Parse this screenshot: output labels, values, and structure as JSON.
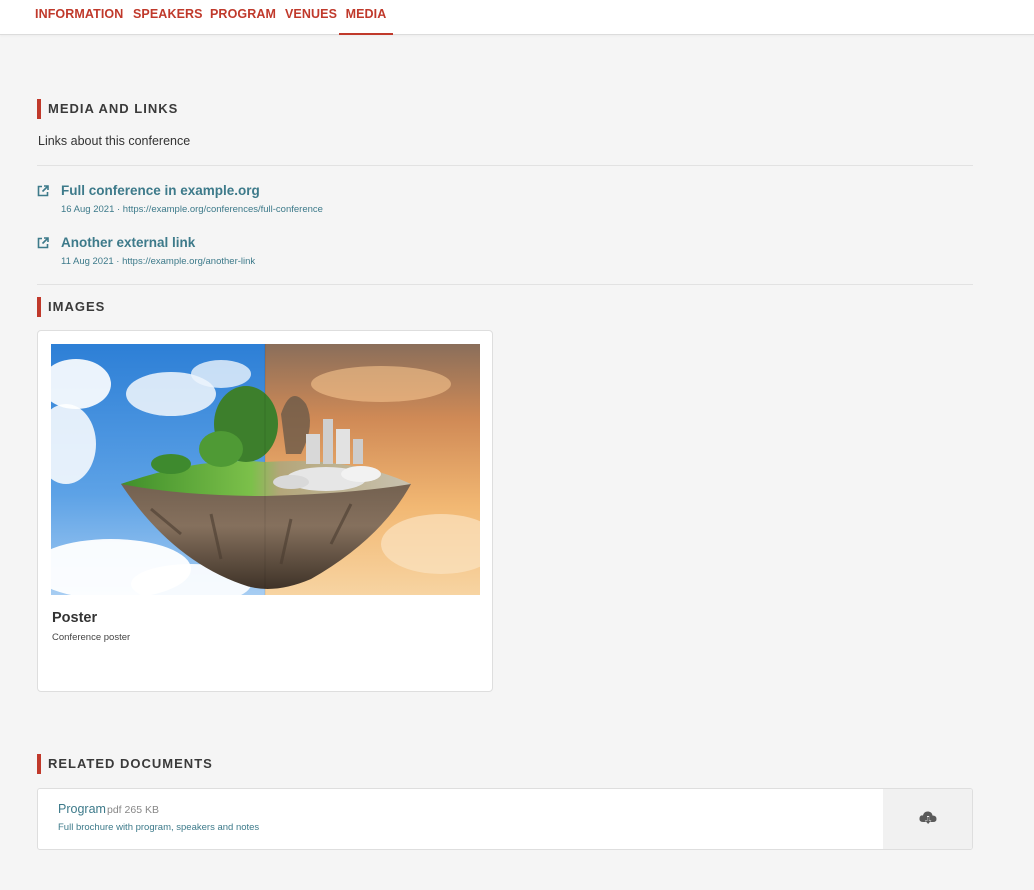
{
  "nav": {
    "tabs": [
      {
        "label": "INFORMATION"
      },
      {
        "label": "SPEAKERS"
      },
      {
        "label": "PROGRAM"
      },
      {
        "label": "VENUES"
      },
      {
        "label": "MEDIA"
      }
    ],
    "active_tab": "MEDIA"
  },
  "media_links": {
    "heading": "MEDIA AND LINKS",
    "description": "Links about this conference",
    "links": [
      {
        "title": "Full conference in example.org",
        "meta": "16 Aug 2021 · https://example.org/conferences/full-conference",
        "icon": "external-link-icon"
      },
      {
        "title": "Another external link",
        "meta": "11 Aug 2021 · https://example.org/another-link",
        "icon": "external-link-icon"
      }
    ]
  },
  "images": {
    "heading": "IMAGES",
    "items": [
      {
        "title": "Poster",
        "caption": "Conference poster"
      }
    ]
  },
  "related_documents": {
    "heading": "RELATED DOCUMENTS",
    "items": [
      {
        "name": "Program",
        "type": "pdf 265 KB",
        "description": "Full brochure with program, speakers and notes",
        "icon": "cloud-download-icon"
      }
    ]
  },
  "colors": {
    "accent": "#c0392b",
    "link": "#3d7a8a",
    "background": "#f5f5f5"
  }
}
